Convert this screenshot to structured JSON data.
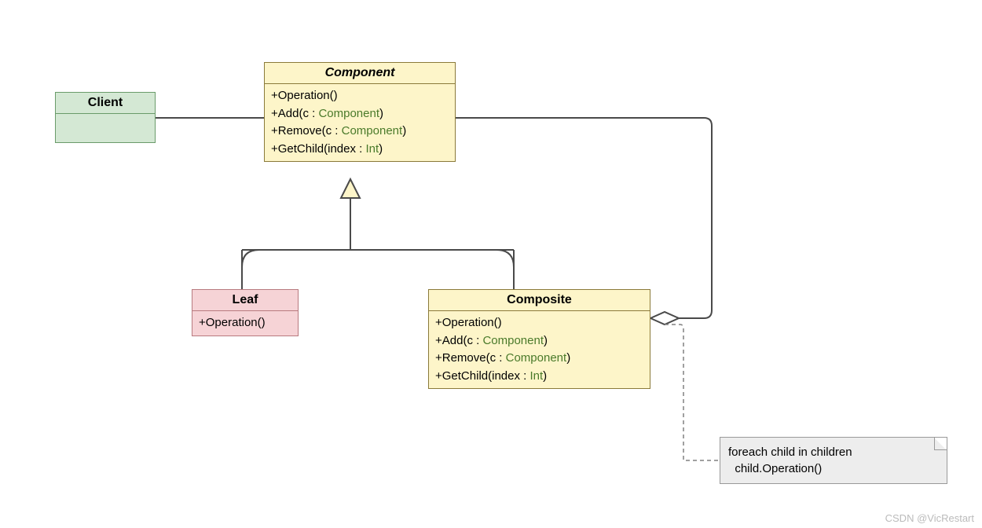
{
  "diagram": {
    "client": {
      "title": "Client"
    },
    "component": {
      "title": "Component",
      "ops": {
        "op1": "+Operation()",
        "op2_pre": "+Add(c : ",
        "op2_type": "Component",
        "op2_post": ")",
        "op3_pre": "+Remove(c : ",
        "op3_type": "Component",
        "op3_post": ")",
        "op4_pre": "+GetChild(index : ",
        "op4_type": "Int",
        "op4_post": ")"
      }
    },
    "leaf": {
      "title": "Leaf",
      "ops": {
        "op1": "+Operation()"
      }
    },
    "composite": {
      "title": "Composite",
      "ops": {
        "op1": "+Operation()",
        "op2_pre": "+Add(c : ",
        "op2_type": "Component",
        "op2_post": ")",
        "op3_pre": "+Remove(c : ",
        "op3_type": "Component",
        "op3_post": ")",
        "op4_pre": "+GetChild(index : ",
        "op4_type": "Int",
        "op4_post": ")"
      }
    },
    "note": {
      "line1": "foreach child in children",
      "line2": "  child.Operation()"
    }
  },
  "watermark": "CSDN @VicRestart"
}
